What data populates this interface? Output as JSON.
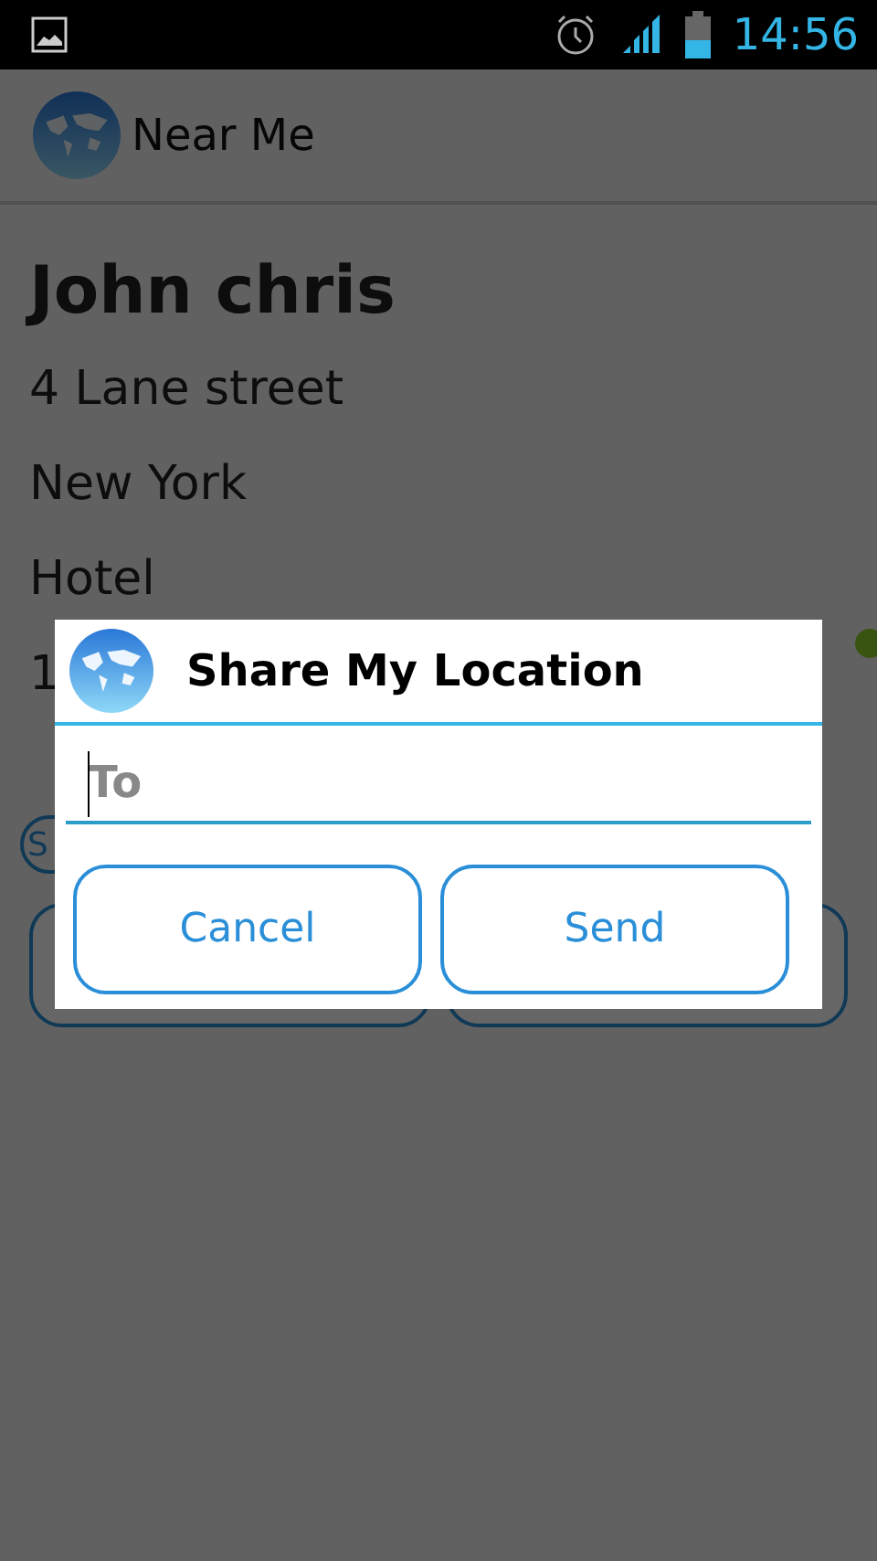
{
  "status_bar": {
    "time": "14:56"
  },
  "action_bar": {
    "title": "Near Me"
  },
  "details": {
    "name": "John chris",
    "lines": [
      "4 Lane street",
      "New York",
      "Hotel",
      "1"
    ],
    "pill": "S"
  },
  "dialog": {
    "title": "Share My Location",
    "field": {
      "placeholder": "To"
    },
    "buttons": [
      "Cancel",
      "Send"
    ]
  }
}
